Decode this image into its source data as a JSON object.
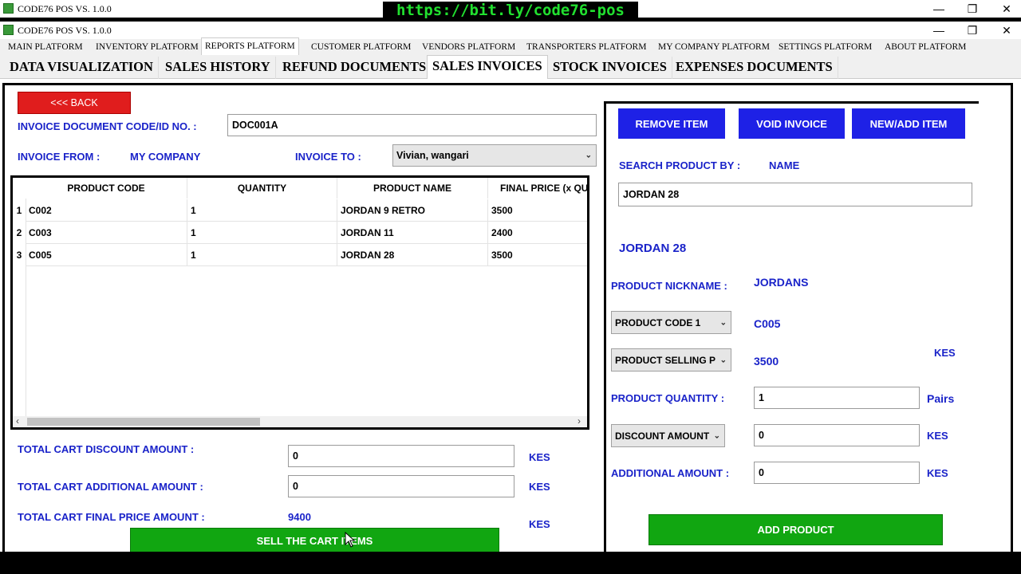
{
  "app": {
    "title": "CODE76 POS VS. 1.0.0",
    "banner": "https://bit.ly/code76-pos",
    "window_controls": {
      "minimize": "—",
      "restore": "❐",
      "close": "✕"
    }
  },
  "platform_menu": [
    "MAIN PLATFORM",
    "INVENTORY PLATFORM",
    "REPORTS PLATFORM",
    "CUSTOMER PLATFORM",
    "VENDORS PLATFORM",
    "TRANSPORTERS PLATFORM",
    "MY COMPANY PLATFORM",
    "SETTINGS PLATFORM",
    "ABOUT PLATFORM"
  ],
  "sub_tabs": [
    "DATA VISUALIZATION",
    "SALES HISTORY",
    "REFUND DOCUMENTS",
    "SALES INVOICES",
    "STOCK INVOICES",
    "EXPENSES DOCUMENTS"
  ],
  "left": {
    "back_label": "<<< BACK",
    "invoice_code_label": "INVOICE DOCUMENT CODE/ID NO. :",
    "invoice_code_value": "DOC001A",
    "invoice_from_label": "INVOICE FROM   :",
    "invoice_from_value": "MY COMPANY",
    "invoice_to_label": "INVOICE TO   :",
    "invoice_to_value": "Vivian, wangari",
    "table": {
      "columns": [
        "PRODUCT CODE",
        "QUANTITY",
        "PRODUCT NAME",
        "FINAL PRICE (x QUAN"
      ],
      "rows": [
        {
          "num": "1",
          "code": "C002",
          "qty": "1",
          "name": "JORDAN 9 RETRO",
          "price": "3500"
        },
        {
          "num": "2",
          "code": "C003",
          "qty": "1",
          "name": "JORDAN 11",
          "price": "2400"
        },
        {
          "num": "3",
          "code": "C005",
          "qty": "1",
          "name": "JORDAN 28",
          "price": "3500"
        }
      ],
      "scroll_left": "‹",
      "scroll_right": "›"
    },
    "discount_label": "TOTAL CART  DISCOUNT AMOUNT   :",
    "discount_value": "0",
    "additional_label": "TOTAL CART  ADDITIONAL AMOUNT   :",
    "additional_value": "0",
    "final_label": "TOTAL CART FINAL PRICE AMOUNT   :",
    "final_value": "9400",
    "currency": "KES",
    "sell_label": "SELL THE CART ITEMS"
  },
  "right": {
    "remove_label": "REMOVE ITEM",
    "void_label": "VOID INVOICE",
    "new_label": "NEW/ADD ITEM",
    "search_by_label": "SEARCH PRODUCT BY :",
    "search_by_value": "NAME",
    "search_value": "JORDAN 28",
    "product_title": "JORDAN 28",
    "nickname_label": "PRODUCT NICKNAME :",
    "nickname_value": "JORDANS",
    "code_select": "PRODUCT CODE 1",
    "code_value": "C005",
    "price_select": "PRODUCT SELLING P",
    "price_value": "3500",
    "currency": "KES",
    "quantity_label": "PRODUCT QUANTITY :",
    "quantity_value": "1",
    "quantity_unit": "Pairs",
    "discount_select": "DISCOUNT AMOUNT",
    "discount_value": "0",
    "additional_label": "ADDITIONAL AMOUNT :",
    "additional_value": "0",
    "add_label": "ADD PRODUCT"
  }
}
